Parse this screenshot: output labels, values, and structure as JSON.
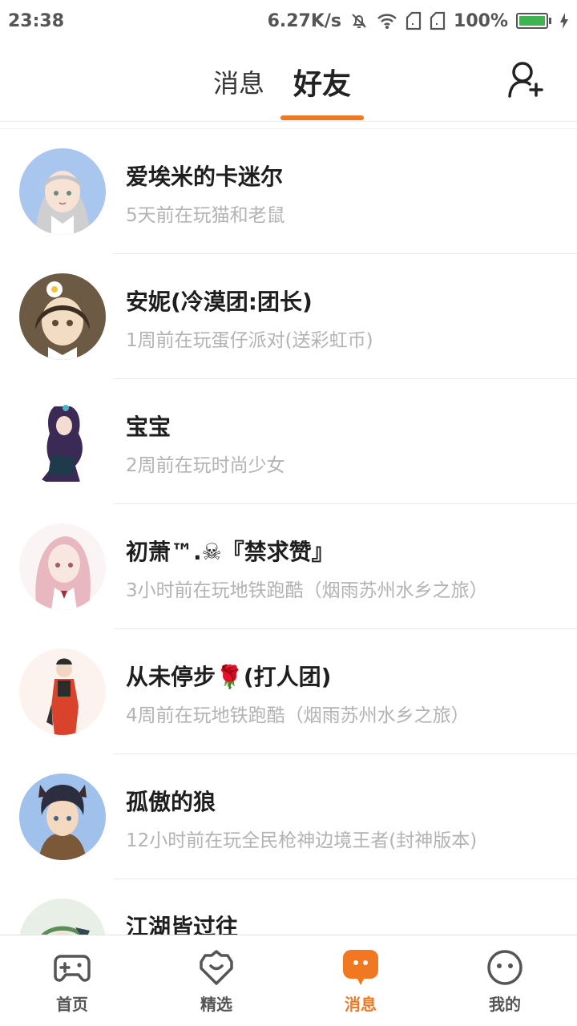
{
  "status_bar": {
    "time": "23:38",
    "net_speed": "6.27K/s",
    "battery": "100%",
    "icons": [
      "mute-bell-icon",
      "wifi-icon",
      "sim1-icon",
      "sim2-icon",
      "battery-icon",
      "charging-icon"
    ]
  },
  "header": {
    "tabs": [
      {
        "label": "消息",
        "active": false
      },
      {
        "label": "好友",
        "active": true
      }
    ],
    "add_friend_icon": "add-user-icon",
    "accent": "#f07823"
  },
  "friends": [
    {
      "name": "爱埃米的卡迷尔",
      "status": "5天前在玩猫和老鼠"
    },
    {
      "name": "安妮(冷漠团:团长)",
      "status": "1周前在玩蛋仔派对(送彩虹币)"
    },
    {
      "name": "宝宝",
      "status": "2周前在玩时尚少女"
    },
    {
      "name": "初萧™.☠『禁求赞』",
      "status": "3小时前在玩地铁跑酷（烟雨苏州水乡之旅）"
    },
    {
      "name": "从未停步🌹(打人团)",
      "status": "4周前在玩地铁跑酷（烟雨苏州水乡之旅）"
    },
    {
      "name": "孤傲的狼",
      "status": "12小时前在玩全民枪神边境王者(封神版本)"
    },
    {
      "name": "江湖皆过往",
      "status": ""
    }
  ],
  "bottom_nav": [
    {
      "label": "首页",
      "icon": "gamepad-icon",
      "active": false
    },
    {
      "label": "精选",
      "icon": "heart-badge-icon",
      "active": false
    },
    {
      "label": "消息",
      "icon": "chat-bubble-icon",
      "active": true
    },
    {
      "label": "我的",
      "icon": "face-icon",
      "active": false
    }
  ]
}
